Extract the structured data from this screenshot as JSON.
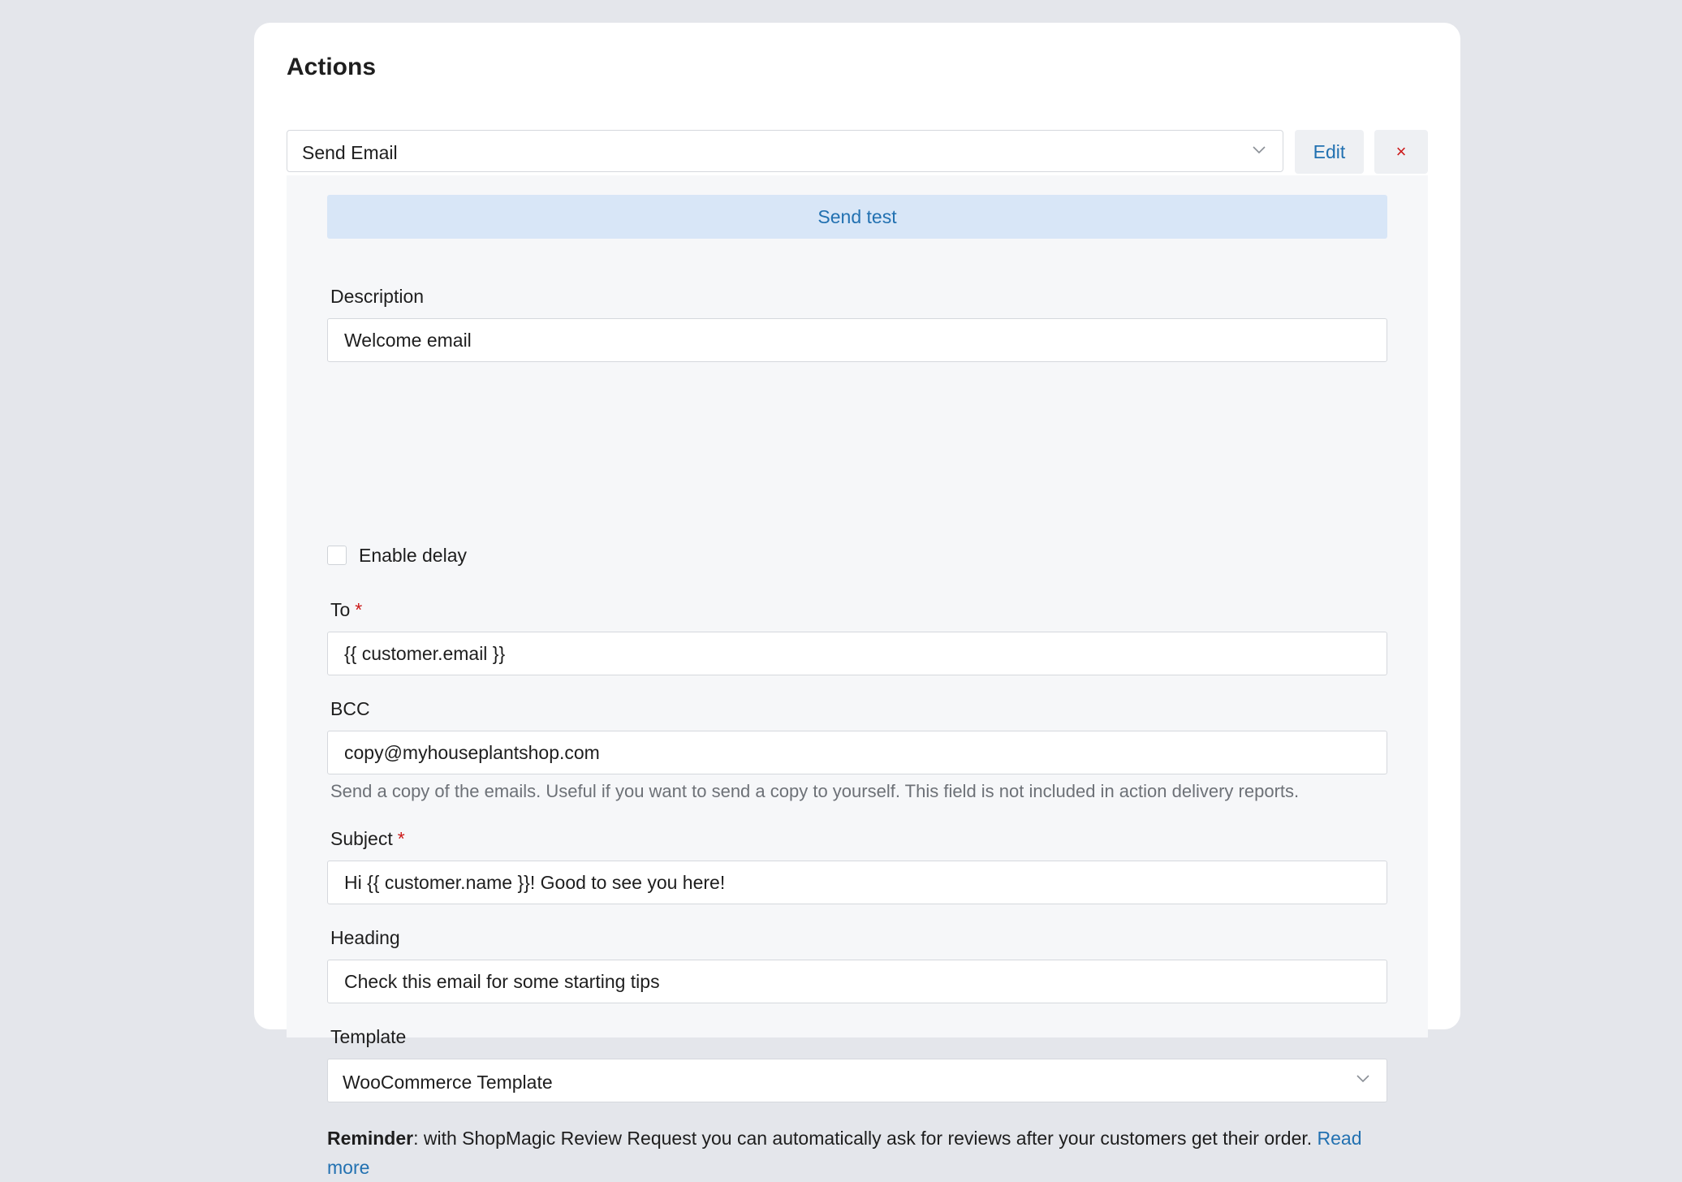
{
  "card": {
    "title": "Actions"
  },
  "action": {
    "selected": "Send Email",
    "edit_label": "Edit",
    "remove_symbol": "×"
  },
  "form": {
    "send_test_label": "Send test",
    "description": {
      "label": "Description",
      "value": "Welcome email"
    },
    "delay": {
      "label": "Enable delay",
      "checked": false
    },
    "to": {
      "label": "To",
      "required_mark": "*",
      "value": "{{ customer.email }}"
    },
    "bcc": {
      "label": "BCC",
      "value": "copy@myhouseplantshop.com",
      "help": "Send a copy of the emails. Useful if you want to send a copy to yourself. This field is not included in action delivery reports."
    },
    "subject": {
      "label": "Subject",
      "required_mark": "*",
      "value": "Hi {{ customer.name }}! Good to see you here!"
    },
    "heading": {
      "label": "Heading",
      "value": "Check this email for some starting tips"
    },
    "template": {
      "label": "Template",
      "value": "WooCommerce Template"
    },
    "reminder": {
      "bold": "Reminder",
      "text": ": with ShopMagic Review Request you can automatically ask for reviews after your customers get their order. ",
      "link": "Read more"
    }
  },
  "colors": {
    "accent": "#2271b1",
    "danger": "#cc1818",
    "page_bg": "#e4e6eb",
    "panel_bg": "#f6f7f9",
    "send_test_bg": "#d8e6f7"
  },
  "icons": {
    "select_chevron": "chevron-down-icon",
    "remove": "close-icon"
  }
}
